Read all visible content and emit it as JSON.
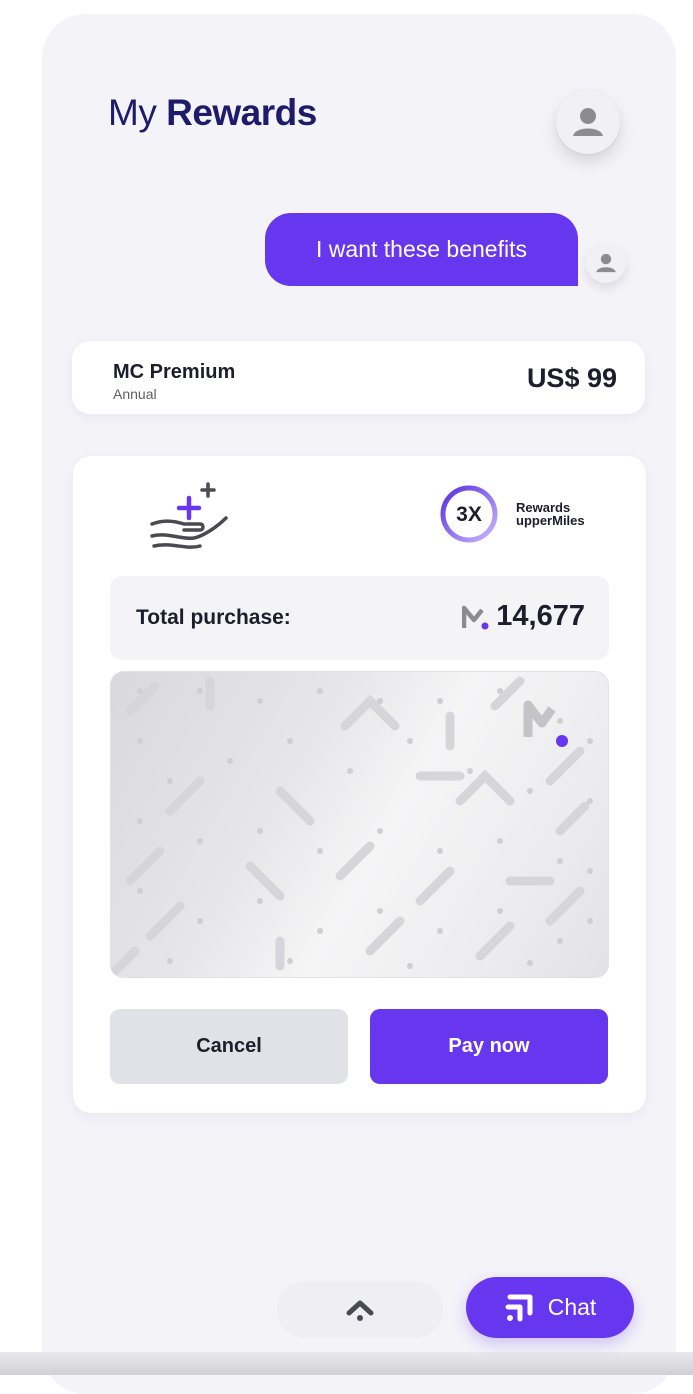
{
  "header": {
    "title_light": "My",
    "title_bold": "Rewards"
  },
  "chat": {
    "message": "I want these benefits"
  },
  "plan": {
    "name": "MC Premium",
    "period": "Annual",
    "price": "US$ 99"
  },
  "rewards": {
    "multiplier": "3X",
    "label_line1": "Rewards",
    "label_line2": "upperMiles"
  },
  "purchase": {
    "label": "Total purchase:",
    "value": "14,677"
  },
  "actions": {
    "cancel_label": "Cancel",
    "pay_label": "Pay now"
  },
  "bottom": {
    "chat_label": "Chat"
  },
  "colors": {
    "accent": "#6637ee",
    "title": "#1e1b6b",
    "background": "#f3f3f8"
  },
  "icons": [
    "user-avatar-icon",
    "hand-plus-icon",
    "miles-logo-icon",
    "chevron-up-icon",
    "chat-icon"
  ]
}
